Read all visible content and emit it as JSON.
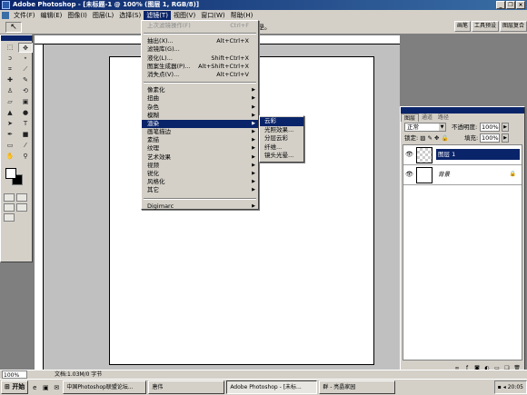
{
  "window": {
    "title": "Adobe Photoshop - [未标题-1 @ 100% (图层 1, RGB/8)]",
    "controls": [
      "_",
      "❐",
      "×"
    ]
  },
  "menubar": {
    "items": [
      "文件(F)",
      "编辑(E)",
      "图像(I)",
      "图层(L)",
      "选择(S)",
      "滤镜(T)",
      "视图(V)",
      "窗口(W)",
      "帮助(H)"
    ],
    "active_index": 5
  },
  "options_bar": {
    "tool_glyph": "↖",
    "label": "是。",
    "wells": [
      "画笔",
      "工具预设",
      "图层复合"
    ]
  },
  "filter_menu": {
    "items": [
      {
        "label": "上次滤镜操作(F)",
        "shortcut": "Ctrl+F",
        "disabled": true
      },
      {
        "sep": true
      },
      {
        "label": "抽出(X)...",
        "shortcut": "Alt+Ctrl+X"
      },
      {
        "label": "滤镜库(G)...",
        "shortcut": ""
      },
      {
        "label": "液化(L)...",
        "shortcut": "Shift+Ctrl+X"
      },
      {
        "label": "图案生成器(P)...",
        "shortcut": "Alt+Shift+Ctrl+X"
      },
      {
        "label": "消失点(V)...",
        "shortcut": "Alt+Ctrl+V"
      },
      {
        "sep": true
      },
      {
        "label": "像素化",
        "submenu": true
      },
      {
        "label": "扭曲",
        "submenu": true
      },
      {
        "label": "杂色",
        "submenu": true
      },
      {
        "label": "模糊",
        "submenu": true
      },
      {
        "label": "渲染",
        "submenu": true,
        "highlighted": true
      },
      {
        "label": "画笔描边",
        "submenu": true
      },
      {
        "label": "素描",
        "submenu": true
      },
      {
        "label": "纹理",
        "submenu": true
      },
      {
        "label": "艺术效果",
        "submenu": true
      },
      {
        "label": "视频",
        "submenu": true
      },
      {
        "label": "锐化",
        "submenu": true
      },
      {
        "label": "风格化",
        "submenu": true
      },
      {
        "label": "其它",
        "submenu": true
      },
      {
        "sep": true
      },
      {
        "label": "Digimarc",
        "submenu": true
      }
    ]
  },
  "render_submenu": {
    "items": [
      "云彩",
      "光照效果...",
      "分层云彩",
      "纤维...",
      "镜头光晕..."
    ],
    "highlighted_index": 0
  },
  "layers_panel": {
    "tabs": [
      "图层",
      "通道",
      "路径"
    ],
    "blend_mode": "正常",
    "opacity_label": "不透明度:",
    "opacity_value": "100%",
    "lock_label": "锁定:",
    "fill_label": "填充:",
    "fill_value": "100%",
    "layers": [
      {
        "name": "图层 1",
        "selected": true,
        "transparent": true
      },
      {
        "name": "背景",
        "selected": false,
        "italic": true,
        "locked": true
      }
    ]
  },
  "status_bar": {
    "zoom": "100%",
    "doc_info": "文档:1.03M/0 字节"
  },
  "taskbar": {
    "start_label": "开始",
    "tasks": [
      {
        "label": "中国Photoshop联盟论坛...",
        "active": false
      },
      {
        "label": "唐伟",
        "active": false
      },
      {
        "label": "Adobe Photoshop - [未标...",
        "active": true
      },
      {
        "label": "群 - 亮晶家园",
        "active": false
      }
    ],
    "clock": "20:05"
  }
}
